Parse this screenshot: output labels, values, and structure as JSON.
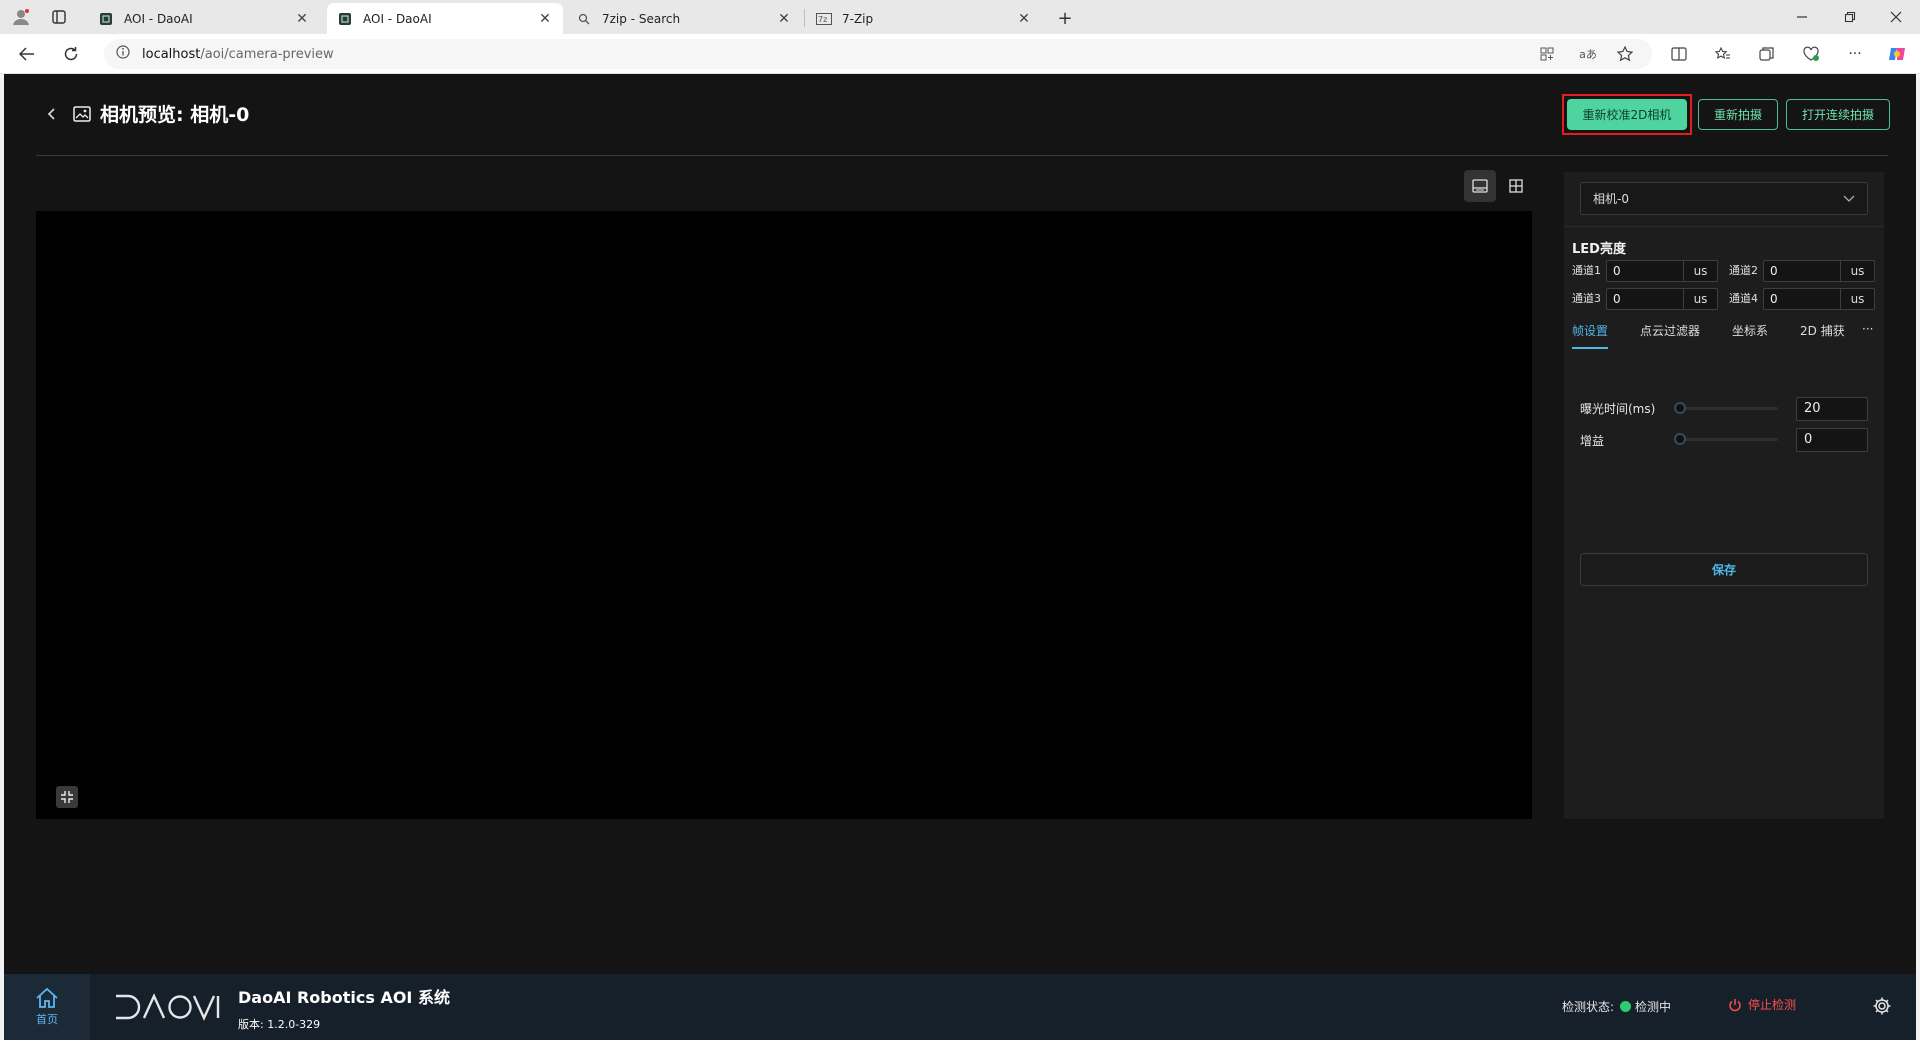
{
  "browser": {
    "tabs": [
      {
        "title": "AOI - DaoAI",
        "active": false
      },
      {
        "title": "AOI - DaoAI",
        "active": true
      },
      {
        "title": "7zip - Search",
        "active": false
      },
      {
        "title": "7-Zip",
        "active": false
      }
    ],
    "url_host": "localhost",
    "url_path": "/aoi/camera-preview"
  },
  "header": {
    "title": "相机预览: 相机-0",
    "btn_recalibrate": "重新校准2D相机",
    "btn_recapture": "重新拍摄",
    "btn_continuous": "打开连续拍摄"
  },
  "panel": {
    "camera_selected": "相机-0",
    "led_title": "LED亮度",
    "channels": [
      {
        "label": "通道1",
        "value": "0",
        "unit": "us"
      },
      {
        "label": "通道2",
        "value": "0",
        "unit": "us"
      },
      {
        "label": "通道3",
        "value": "0",
        "unit": "us"
      },
      {
        "label": "通道4",
        "value": "0",
        "unit": "us"
      }
    ],
    "tabs": [
      "帧设置",
      "点云过滤器",
      "坐标系",
      "2D 捕获"
    ],
    "more": "···",
    "exposure_label": "曝光时间(ms)",
    "exposure_value": "20",
    "gain_label": "增益",
    "gain_value": "0",
    "save": "保存"
  },
  "footer": {
    "home": "首页",
    "system_name": "DaoAI Robotics AOI 系统",
    "version": "版本: 1.2.0-329",
    "status_label": "检测状态:",
    "status_value": "检测中",
    "stop": "停止检测"
  },
  "colors": {
    "accent_green": "#4fd4a0",
    "accent_blue": "#4fb8e8",
    "status_green": "#2ecc71",
    "danger_red": "#ff4d4d"
  }
}
